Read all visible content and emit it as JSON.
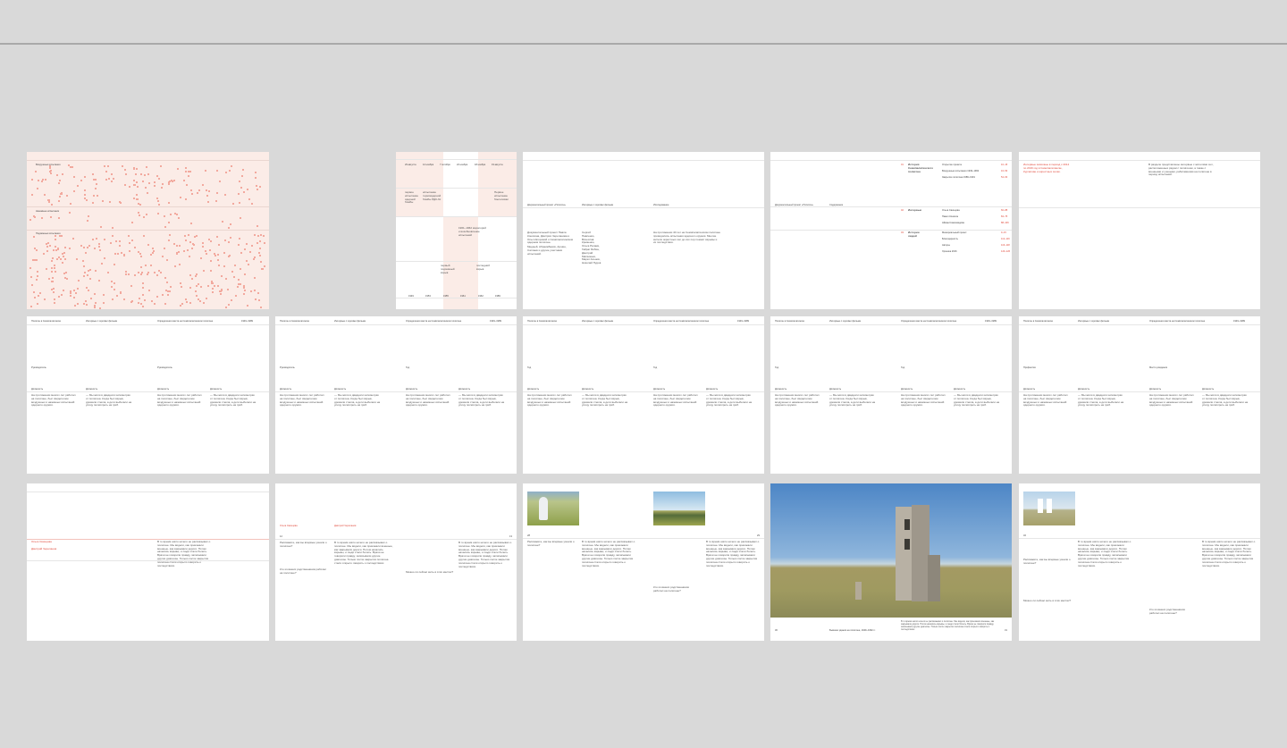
{
  "colors": {
    "background": "#d9d9d9",
    "accent": "#e0483a",
    "pink": "#fbece7"
  },
  "s1": {
    "labels": [
      "Воздушные испытания",
      "Наземные испытания",
      "Подземные испытания"
    ]
  },
  "s2": {
    "dates": [
      "29 августа",
      "12 ноября",
      "7 октября",
      "22 ноября",
      "18 ноября",
      "19 августа"
    ],
    "events": [
      "первое испытание ядерной бомбы",
      "испытание термоядерной бомбы РДС-6с",
      "Первое испытание боеголовки",
      "1961–1962 мораторий и возобновление испытаний",
      "первый подземный взрыв",
      "последний взрыв"
    ],
    "years": [
      "1949",
      "1953",
      "1955",
      "1961",
      "1962",
      "1989"
    ]
  },
  "s3": {
    "col1": "Документальный проект «Полигон»",
    "col2": "Интервью с героями фильма",
    "col3": "Исследование",
    "p1": "Документальный проект Павла Коняхина, Дмитрия Черепанова и Ольги Егоровой о Семипалатинском ядерном полигоне.",
    "p2": "Медный, Абраимбеков, Аршин, Сатпаев и другие участники испытаний.",
    "names": "Сергей Павленко, Вячеслав Кременко, Ольга Ралаки, Гайрат Бибин, Дмитрий Матвиенко, Марат Асенов, Николай Пудов",
    "p3": "На протяжении 40 лет на Семипалатинском полигоне проводились испытания ядерного оружия. Многие жители окрестных сел до сих пор помнят взрывы и их последствия."
  },
  "s4": {
    "left": "Документальный проект «Полигон»",
    "left2": "Содержание",
    "sections": [
      {
        "num": "01",
        "title": "История Семипалатинского полигона",
        "items": [
          [
            "Открытие проекта",
            "10–15"
          ],
          [
            "Воздушные испытания 1949–1962",
            "16–53"
          ],
          [
            "Закрытие полигона 1989–1991",
            "54–63"
          ]
        ]
      },
      {
        "num": "02",
        "title": "Интервью",
        "items": [
          [
            "Ольга Свинцова",
            "66–88"
          ],
          [
            "Павел Коняхин",
            "84–75"
          ],
          [
            "Айман Кожахмедова",
            "88–106"
          ]
        ]
      },
      {
        "num": "03",
        "title": "Истории людей",
        "items": [
          [
            "Мемориальный проект",
            "9–15"
          ],
          [
            "Благодарность",
            "112–116"
          ],
          [
            "Авторы",
            "116–118"
          ],
          [
            "Хроника 2016",
            "120–126"
          ]
        ]
      }
    ]
  },
  "s5": {
    "red": "Интервью записаны в период с 2014 по 2016 год в Семипалатинске, Курчатове и окрестных селах.",
    "text": "В разделе представлены интервью с жителями сел, расположенных рядом с полигоном, а также с военными и учеными, работавшими на полигоне в период испытаний."
  },
  "runhead": {
    "left": "Полигон в Семипалатинске",
    "mid": "Интервью с героями фильма",
    "right": "Определения места на Семипалатинском полигоне",
    "years": "1949–1989"
  },
  "row2": {
    "label1": "Руководитель",
    "label2": "Должность",
    "label3": "Профессия",
    "label4": "Место рождения",
    "label5": "Год",
    "para": "На протяжении многих лет работал на полигоне, был свидетелем воздушных и наземных испытаний ядерного оружия.",
    "para2": "— Мы жили в двадцати километрах от полигона. Когда был взрыв, дрожали стекла, а дети выбегали на улицу посмотреть на гриб."
  },
  "row3": {
    "red1": "Ольга Свинцова",
    "red2": "Дмитрий Черепанов",
    "caption": "Бывшие здания на полигоне, 1949–1962 гг.",
    "q1": "Расскажите, как вы впервые узнали о полигоне?",
    "q2": "Кто из ваших родственников работал на полигоне?",
    "q3": "Можно ли сейчас жить в этих местах?",
    "body": "В то время никто ничего не рассказывал о полигоне. Мы видели, как приезжали военные, как закрывали дороги. Потом начались взрывы, и люди стали болеть. Врачи не говорили правду, записывали другие диагнозы. Только после закрытия полигона стали открыто говорить о последствиях.",
    "pages": [
      "12",
      "13",
      "28",
      "29",
      "30",
      "31",
      "32"
    ]
  }
}
